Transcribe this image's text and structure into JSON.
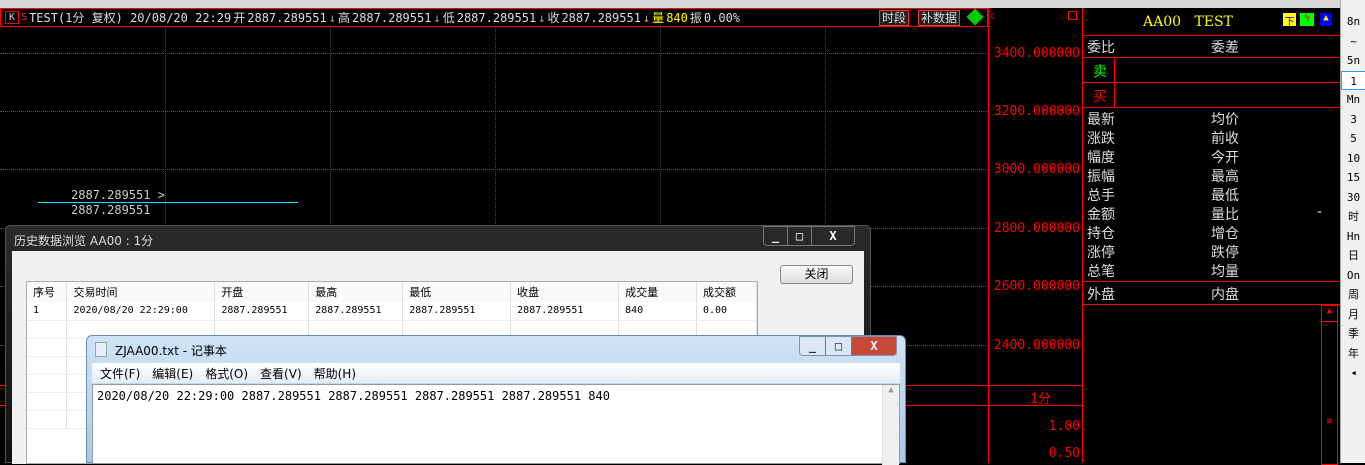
{
  "header": {
    "k_label": "K",
    "s_label": "S",
    "title": "TEST(1分 复权) 20/08/20 22:29",
    "open_label": "开",
    "open": "2887.289551",
    "high_label": "高",
    "high": "2887.289551",
    "low_label": "低",
    "low": "2887.289551",
    "close_label": "收",
    "close": "2887.289551",
    "vol_label": "量",
    "vol": "840",
    "amp_label": "振",
    "amp": "0.00%",
    "btn_period": "时段",
    "btn_fill": "补数据"
  },
  "chart": {
    "price_axis": [
      "3400.000000",
      "3200.000000",
      "3000.000000",
      "2800.000000",
      "2600.000000",
      "2400.000000"
    ],
    "marker_label_top": "2887.289551",
    "marker_label_bottom": "2887.289551",
    "period_label": "1分",
    "vol_axis": [
      "1.00",
      "0.50"
    ]
  },
  "quote": {
    "code": "AA00",
    "name": "TEST",
    "wb": "委比",
    "wc": "委差",
    "sell": "卖",
    "buy": "买",
    "left": [
      "最新",
      "涨跌",
      "幅度",
      "振幅",
      "总手",
      "金额",
      "持仓",
      "涨停",
      "总笔"
    ],
    "right": [
      "均价",
      "前收",
      "今开",
      "最高",
      "最低",
      "量比",
      "增仓",
      "跌停",
      "均量"
    ],
    "ratio_value": "-",
    "outer": "外盘",
    "inner": "内盘"
  },
  "sidebar": [
    "8n",
    "~",
    "5n",
    "1",
    "Mn",
    "3",
    "5",
    "10",
    "15",
    "30",
    "时",
    "Hn",
    "日",
    "On",
    "周",
    "月",
    "季",
    "年",
    "◂"
  ],
  "history": {
    "title": "历史数据浏览 AA00 : 1分",
    "close_btn": "关闭",
    "columns": [
      "序号",
      "交易时间",
      "开盘",
      "最高",
      "最低",
      "收盘",
      "成交量",
      "成交额"
    ],
    "rows": [
      [
        "1",
        "2020/08/20 22:29:00",
        "2887.289551",
        "2887.289551",
        "2887.289551",
        "2887.289551",
        "840",
        "0.00"
      ]
    ]
  },
  "notepad": {
    "title": "ZJAA00.txt - 记事本",
    "menu": [
      "文件(F)",
      "编辑(E)",
      "格式(O)",
      "查看(V)",
      "帮助(H)"
    ],
    "content": "2020/08/20 22:29:00 2887.289551 2887.289551 2887.289551 2887.289551 840"
  },
  "colors": {
    "axis": "#ff0000",
    "title": "#ffff00",
    "marker": "#00e5ff"
  }
}
